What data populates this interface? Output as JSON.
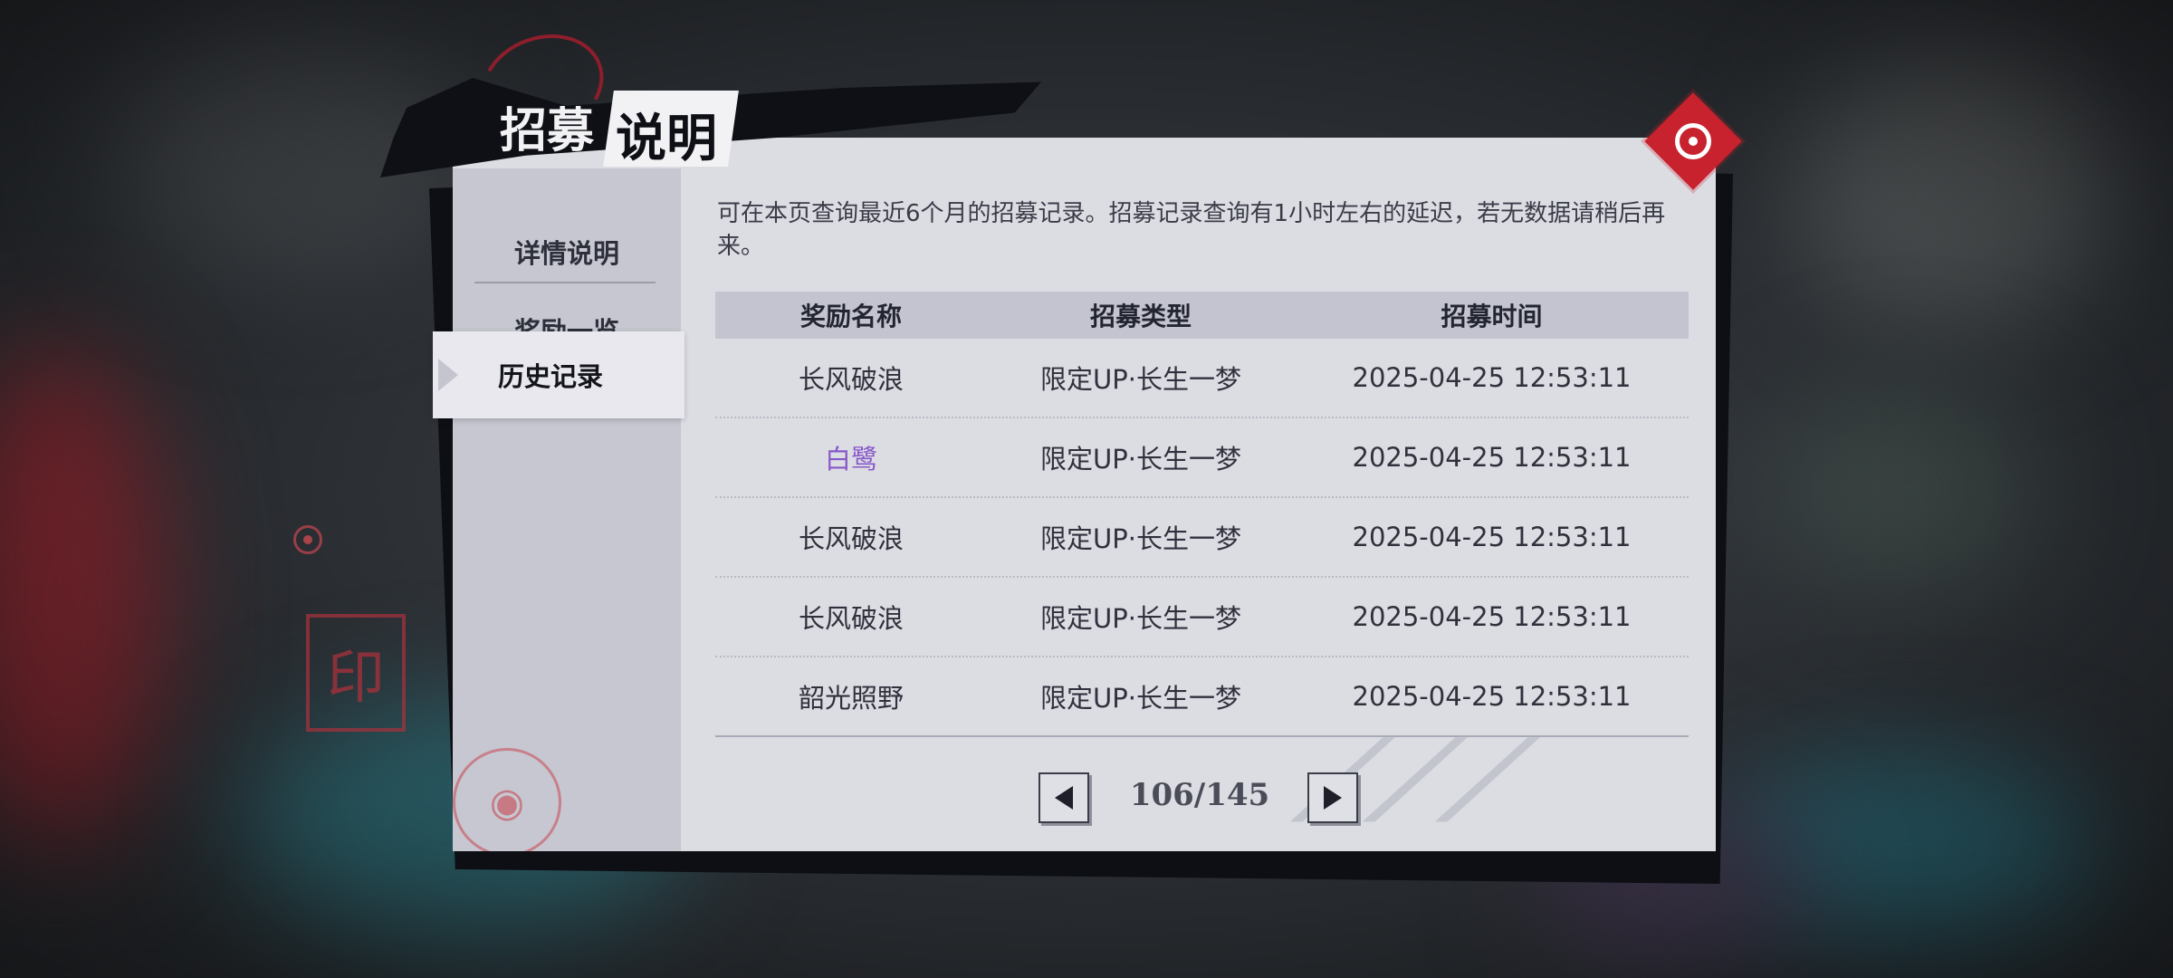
{
  "title": {
    "part1": "招募",
    "part2": "说明"
  },
  "nav": {
    "items": [
      {
        "label": "详情说明"
      },
      {
        "label": "奖励一览"
      },
      {
        "label": "历史记录"
      }
    ],
    "active_index": 2
  },
  "description": "可在本页查询最近6个月的招募记录。招募记录查询有1小时左右的延迟，若无数据请稍后再来。",
  "table": {
    "headers": [
      "奖励名称",
      "招募类型",
      "招募时间"
    ],
    "rows": [
      {
        "name": "长风破浪",
        "type": "限定UP·长生一梦",
        "time": "2025-04-25 12:53:11",
        "highlight": false
      },
      {
        "name": "白鹭",
        "type": "限定UP·长生一梦",
        "time": "2025-04-25 12:53:11",
        "highlight": true
      },
      {
        "name": "长风破浪",
        "type": "限定UP·长生一梦",
        "time": "2025-04-25 12:53:11",
        "highlight": false
      },
      {
        "name": "长风破浪",
        "type": "限定UP·长生一梦",
        "time": "2025-04-25 12:53:11",
        "highlight": false
      },
      {
        "name": "韶光照野",
        "type": "限定UP·长生一梦",
        "time": "2025-04-25 12:53:11",
        "highlight": false
      }
    ]
  },
  "pagination": {
    "indicator": "106/145",
    "current": 106,
    "total": 145
  },
  "icons": {
    "close": "target-close-icon",
    "prev": "arrow-left-icon",
    "next": "arrow-right-icon"
  },
  "colors": {
    "accent_red": "#c8222f",
    "highlight_purple": "#8757c9",
    "panel_bg": "#dcdde3"
  }
}
